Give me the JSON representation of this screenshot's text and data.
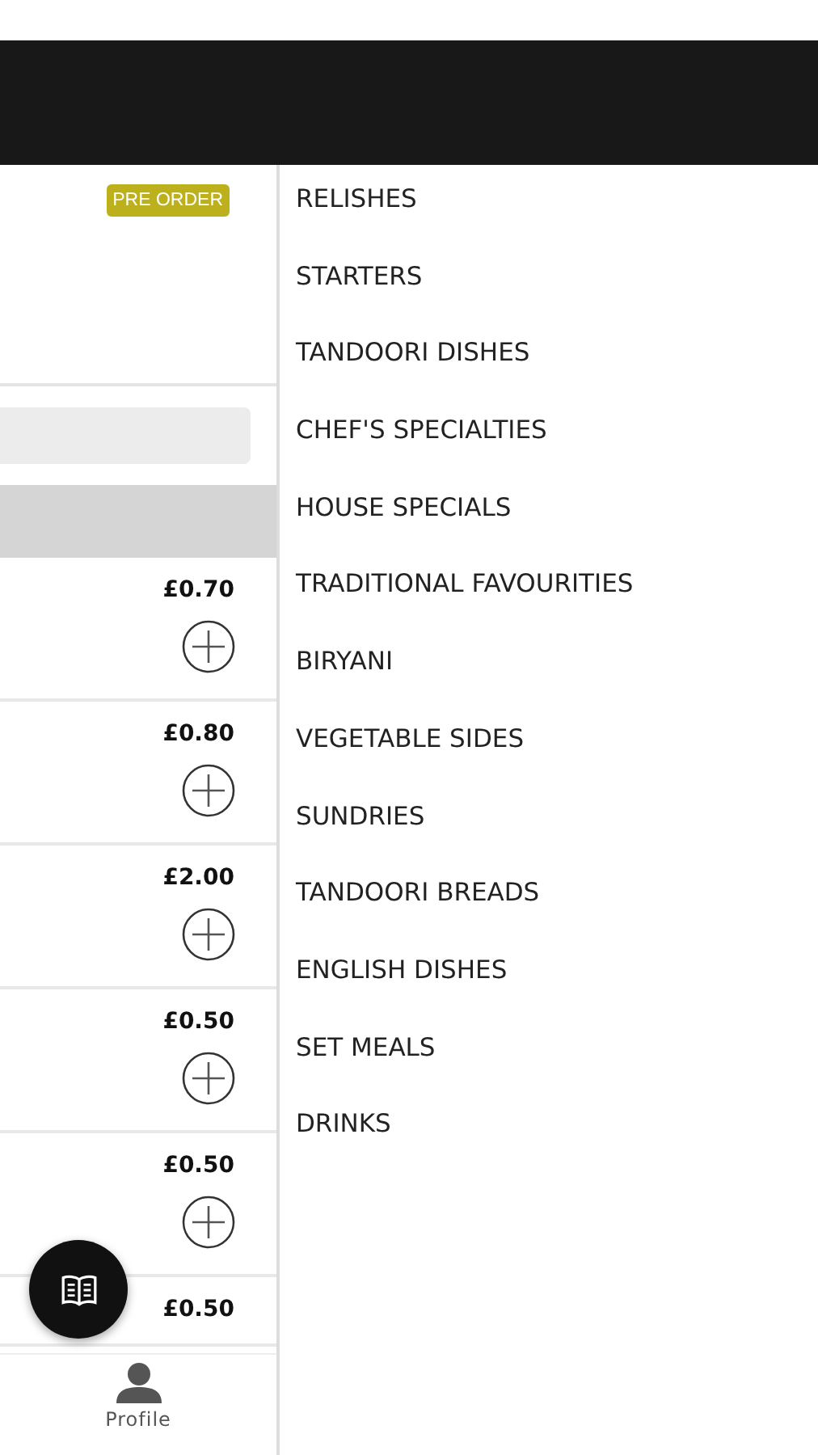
{
  "badge": "PRE ORDER",
  "items": [
    {
      "price": "£0.70",
      "kind": "full"
    },
    {
      "price": "£0.80",
      "kind": "full"
    },
    {
      "price": "£2.00",
      "kind": "full"
    },
    {
      "price": "£0.50",
      "kind": "full"
    },
    {
      "price": "£0.50",
      "kind": "full"
    },
    {
      "price": "£0.50",
      "kind": "cut"
    }
  ],
  "bottom_nav": {
    "label": "Profile"
  },
  "categories": [
    "RELISHES",
    "STARTERS",
    "TANDOORI DISHES",
    "CHEF'S SPECIALTIES",
    "HOUSE SPECIALS",
    "TRADITIONAL FAVOURITIES",
    "BIRYANI",
    "VEGETABLE SIDES",
    "SUNDRIES",
    "TANDOORI BREADS",
    "ENGLISH DISHES",
    "SET MEALS",
    "DRINKS"
  ]
}
